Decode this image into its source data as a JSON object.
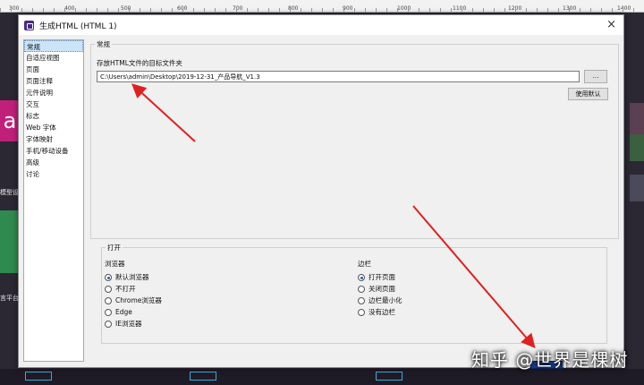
{
  "ruler": {
    "marks": [
      "300",
      "400",
      "500",
      "600",
      "700",
      "800",
      "900",
      "1000",
      "1100",
      "1200",
      "1300",
      "1400"
    ]
  },
  "background": {
    "left_big_letter": "a",
    "left_label_1": "模型设",
    "left_label_2": "言平台"
  },
  "dialog": {
    "title": "生成HTML (HTML 1)",
    "close_label": "×",
    "sidebar": {
      "items": [
        "常规",
        "自适应视图",
        "页面",
        "页面注释",
        "元件说明",
        "交互",
        "标志",
        "Web 字体",
        "字体映射",
        "手机/移动设备",
        "高级",
        "讨论"
      ],
      "selected_index": 0
    },
    "general": {
      "legend": "常规",
      "folder_label": "存放HTML文件的目标文件夹",
      "folder_value": "C:\\Users\\admin\\Desktop\\2019-12-31_产品导航_V1.3",
      "browse_label": "...",
      "use_default_label": "使用默认"
    },
    "open": {
      "legend": "打开",
      "browser": {
        "title": "浏览器",
        "options": [
          "默认浏览器",
          "不打开",
          "Chrome浏览器",
          "Edge",
          "IE浏览器"
        ],
        "selected_index": 0
      },
      "sidebar": {
        "title": "边栏",
        "options": [
          "打开页面",
          "关闭页面",
          "边栏最小化",
          "没有边栏"
        ],
        "selected_index": 0
      }
    }
  },
  "watermark": {
    "text": "知乎 @世界是棵树"
  },
  "colors": {
    "accent": "#1a5fb4",
    "arrow": "#e02020",
    "selected_bg": "#cce4f7"
  }
}
